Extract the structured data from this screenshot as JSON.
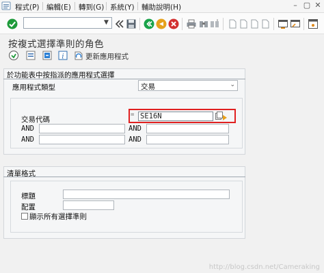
{
  "menu": {
    "items": [
      {
        "label": "程式(P)"
      },
      {
        "label": "編輯(E)"
      },
      {
        "label": "轉到(G)"
      },
      {
        "label": "系統(Y)"
      },
      {
        "label": "輔助說明(H)"
      }
    ]
  },
  "toolbar": {
    "command_value": "",
    "icons": [
      "enter-icon",
      "back-icon",
      "save-icon",
      "exit-icon",
      "cancel-icon",
      "print-icon",
      "find-icon",
      "find-next-icon",
      "page-icon",
      "new-session-icon",
      "shortcut-icon",
      "layout-icon",
      "help-icon"
    ]
  },
  "page": {
    "title": "按複式選擇準則的角色"
  },
  "app_toolbar": {
    "update_label": "更新應用程式"
  },
  "group1": {
    "title": "於功能表中按指派的應用程式選擇",
    "app_type_label": "應用程式類型",
    "app_type_value": "交易",
    "tcode_label": "交易代碼",
    "tcode_value": "SE16N",
    "and_label": "AND"
  },
  "group2": {
    "title": "清單格式",
    "heading_label": "標題",
    "layout_label": "配置",
    "show_all_label": "顯示所有選擇準則"
  },
  "watermark": "http://blog.csdn.net/Cameraking"
}
